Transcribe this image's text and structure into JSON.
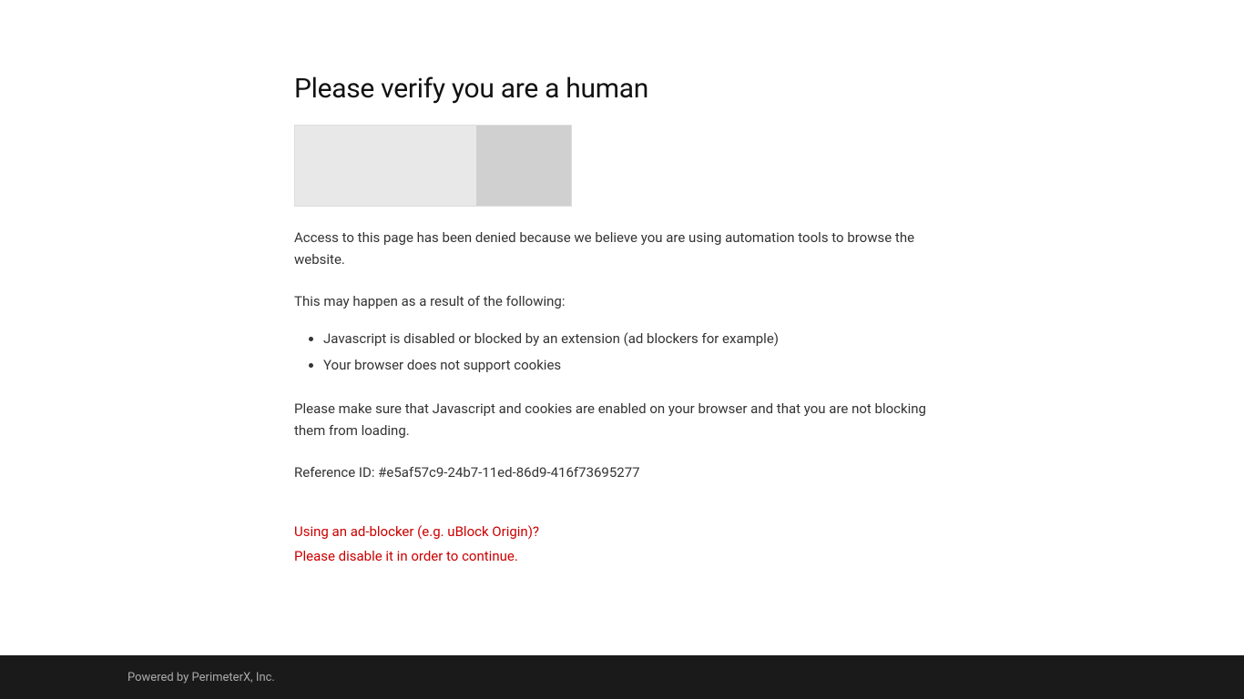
{
  "page": {
    "title": "Please verify you are a human",
    "access_denied": "Access to this page has been denied because we believe you are using automation tools to browse the website.",
    "may_happen": "This may happen as a result of the following:",
    "reasons": [
      "Javascript is disabled or blocked by an extension (ad blockers for example)",
      "Your browser does not support cookies"
    ],
    "make_sure": "Please make sure that Javascript and cookies are enabled on your browser and that you are not blocking them from loading.",
    "reference_label": "Reference ID: #e5af57c9-24b7-11ed-86d9-416f73695277",
    "adblocker_line1": "Using an ad-blocker (e.g. uBlock Origin)?",
    "adblocker_line2": "Please disable it in order to continue."
  },
  "footer": {
    "text": "Powered by PerimeterX",
    "suffix": ", Inc."
  },
  "colors": {
    "accent_red": "#cc0000",
    "footer_bg": "#1a1a1a",
    "footer_text": "#aaaaaa"
  }
}
